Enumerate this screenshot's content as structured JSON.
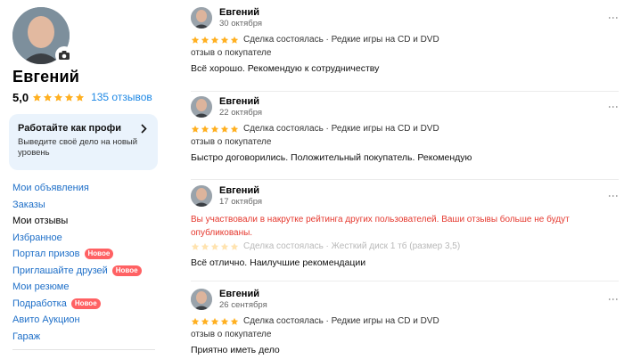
{
  "profile": {
    "name": "Евгений",
    "rating": "5,0",
    "reviews_count": "135 отзывов"
  },
  "promo": {
    "title": "Работайте как профи",
    "text": "Выведите своё дело на новый уровень"
  },
  "nav": {
    "items": [
      {
        "label": "Мои объявления"
      },
      {
        "label": "Заказы"
      },
      {
        "label": "Мои отзывы"
      },
      {
        "label": "Избранное"
      },
      {
        "label": "Портал призов",
        "badge": "Новое"
      },
      {
        "label": "Приглашайте друзей",
        "badge": "Новое"
      },
      {
        "label": "Мои резюме"
      },
      {
        "label": "Подработка",
        "badge": "Новое"
      },
      {
        "label": "Авито Аукцион"
      },
      {
        "label": "Гараж"
      }
    ]
  },
  "reviews": [
    {
      "name": "Евгений",
      "date": "30 октября",
      "meta": "Сделка состоялась · Редкие игры на CD и DVD",
      "role": "отзыв о покупателе",
      "text": "Всё хорошо. Рекомендую к сотрудничеству"
    },
    {
      "name": "Евгений",
      "date": "22 октября",
      "meta": "Сделка состоялась · Редкие игры на CD и DVD",
      "role": "отзыв о покупателе",
      "text": "Быстро договорились. Положительный покупатель. Рекомендую"
    },
    {
      "name": "Евгений",
      "date": "17 октября",
      "warning": "Вы участвовали в накрутке рейтинга других пользователей. Ваши отзывы больше не будут опубликованы.",
      "meta": "Сделка состоялась · Жесткий диск 1 тб (размер 3,5)",
      "text": "Всё отлично. Наилучшие рекомендации"
    },
    {
      "name": "Евгений",
      "date": "26 сентября",
      "meta": "Сделка состоялась · Редкие игры на CD и DVD",
      "role": "отзыв о покупателе",
      "text": "Приятно иметь дело"
    }
  ],
  "colors": {
    "star": "#ffb021",
    "link": "#1e6fc8",
    "badge": "#ff6163",
    "warning": "#e5382e",
    "promo_bg": "#eaf3fc"
  },
  "icons": {
    "camera": "camera-icon",
    "menu": "more-vertical-icon",
    "arrow": "chevron-right-icon",
    "star": "star-icon"
  }
}
